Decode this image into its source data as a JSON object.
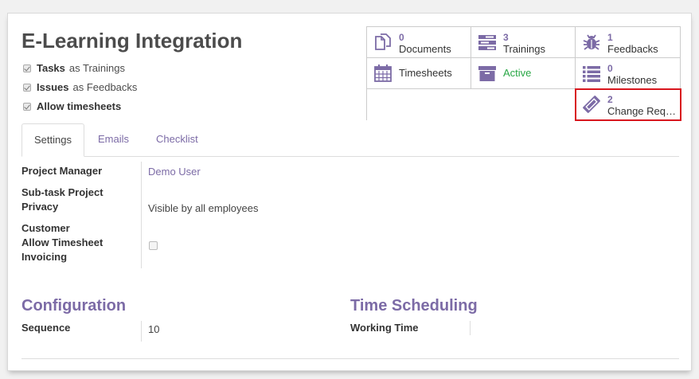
{
  "project": {
    "title": "E-Learning Integration",
    "options": [
      {
        "strong": "Tasks",
        "rest": "as Trainings",
        "checked": true
      },
      {
        "strong": "Issues",
        "rest": "as Feedbacks",
        "checked": true
      },
      {
        "strong": "Allow timesheets",
        "rest": "",
        "checked": true
      }
    ]
  },
  "smart_buttons": [
    {
      "count": "0",
      "label": "Documents",
      "icon": "documents-icon"
    },
    {
      "count": "3",
      "label": "Trainings",
      "icon": "tasks-icon"
    },
    {
      "count": "1",
      "label": "Feedbacks",
      "icon": "bug-icon"
    },
    {
      "count": "",
      "label": "Timesheets",
      "icon": "calendar-icon"
    },
    {
      "count": "",
      "label": "Active",
      "icon": "archive-icon"
    },
    {
      "count": "0",
      "label": "Milestones",
      "icon": "list-icon"
    },
    {
      "count": "2",
      "label": "Change Requests",
      "icon": "ticket-icon"
    }
  ],
  "tabs": [
    "Settings",
    "Emails",
    "Checklist"
  ],
  "settings": {
    "project_manager_label": "Project Manager",
    "project_manager_value": "Demo User",
    "privacy_label": "Sub-task Project Privacy",
    "privacy_value": "Visible by all employees",
    "customer_label": "Customer",
    "timesheet_invoicing_label": "Allow Timesheet Invoicing"
  },
  "configuration": {
    "heading": "Configuration",
    "sequence_label": "Sequence",
    "sequence_value": "10"
  },
  "scheduling": {
    "heading": "Time Scheduling",
    "working_time_label": "Working Time"
  },
  "colors": {
    "accent": "#7c6ba6",
    "active": "#28a745",
    "highlight": "#d8161e"
  }
}
